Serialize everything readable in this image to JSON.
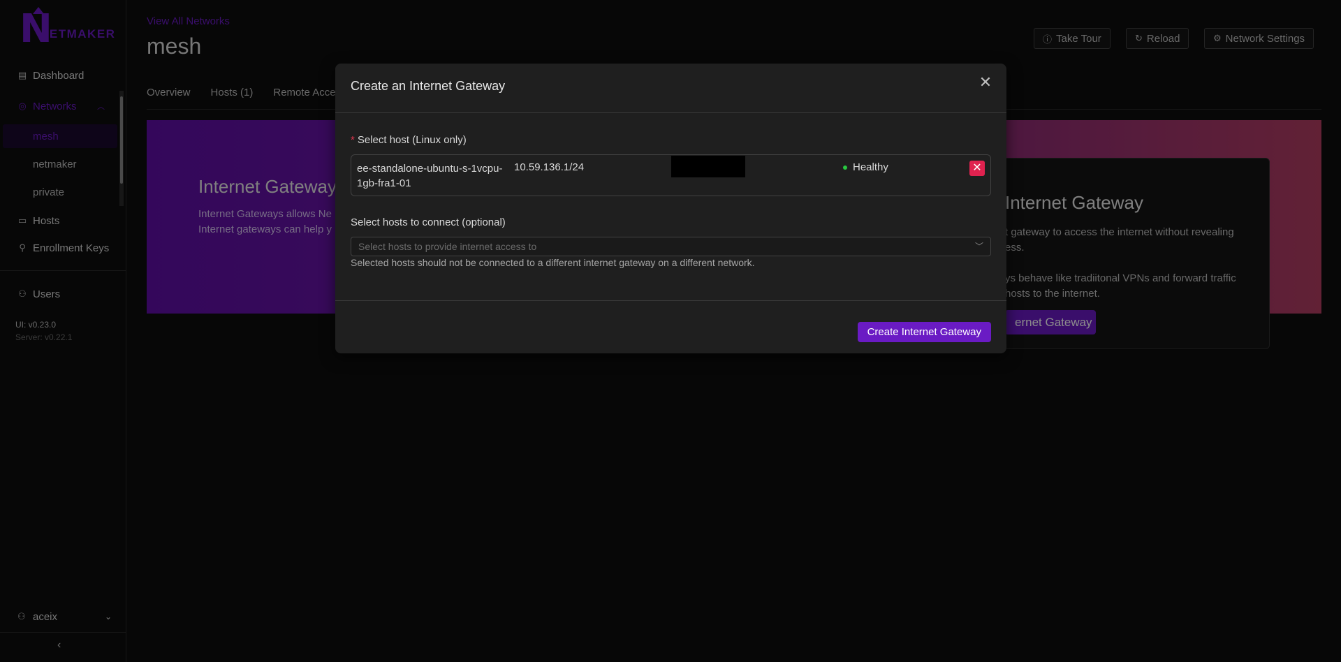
{
  "brand": {
    "logo_letter": "N",
    "logo_text": "ETMAKER",
    "accent": "#6a1bc4"
  },
  "sidebar": {
    "items": [
      {
        "label": "Dashboard",
        "icon": "dashboard-icon"
      },
      {
        "label": "Networks",
        "icon": "globe-icon"
      },
      {
        "label": "Hosts",
        "icon": "laptop-icon"
      },
      {
        "label": "Enrollment Keys",
        "icon": "key-icon"
      },
      {
        "label": "Users",
        "icon": "user-icon"
      }
    ],
    "networks": [
      "mesh",
      "netmaker",
      "private"
    ],
    "ui_version": "UI: v0.23.0",
    "server_version": "Server: v0.22.1",
    "username": "aceix"
  },
  "header": {
    "breadcrumb": "View All Networks",
    "network_name": "mesh",
    "buttons": {
      "tour": "Take Tour",
      "reload": "Reload",
      "settings": "Network Settings"
    }
  },
  "tabs": [
    "Overview",
    "Hosts (1)",
    "Remote Acce"
  ],
  "banner": {
    "title": "Internet Gateway",
    "text_line1": "Internet Gateways allows Ne",
    "text_line2": "Internet gateways can help y"
  },
  "card": {
    "title": "Internet Gateway",
    "text_line1": "t gateway to access the internet without revealing",
    "text_line2": "ess.",
    "text_line3": "ys behave like tradiitonal VPNs and forward traffic",
    "text_line4": "hosts to the internet.",
    "button": "ernet Gateway"
  },
  "modal": {
    "title": "Create an Internet Gateway",
    "host_label": "Select host (Linux only)",
    "selected_host": {
      "name": "ee-standalone-ubuntu-s-1vcpu-1gb-fra1-01",
      "ip": "10.59.136.1/24",
      "status": "Healthy"
    },
    "connect_label": "Select hosts to connect (optional)",
    "connect_placeholder": "Select hosts to provide internet access to",
    "help": "Selected hosts should not be connected to a different internet gateway on a different network.",
    "submit": "Create Internet Gateway"
  }
}
